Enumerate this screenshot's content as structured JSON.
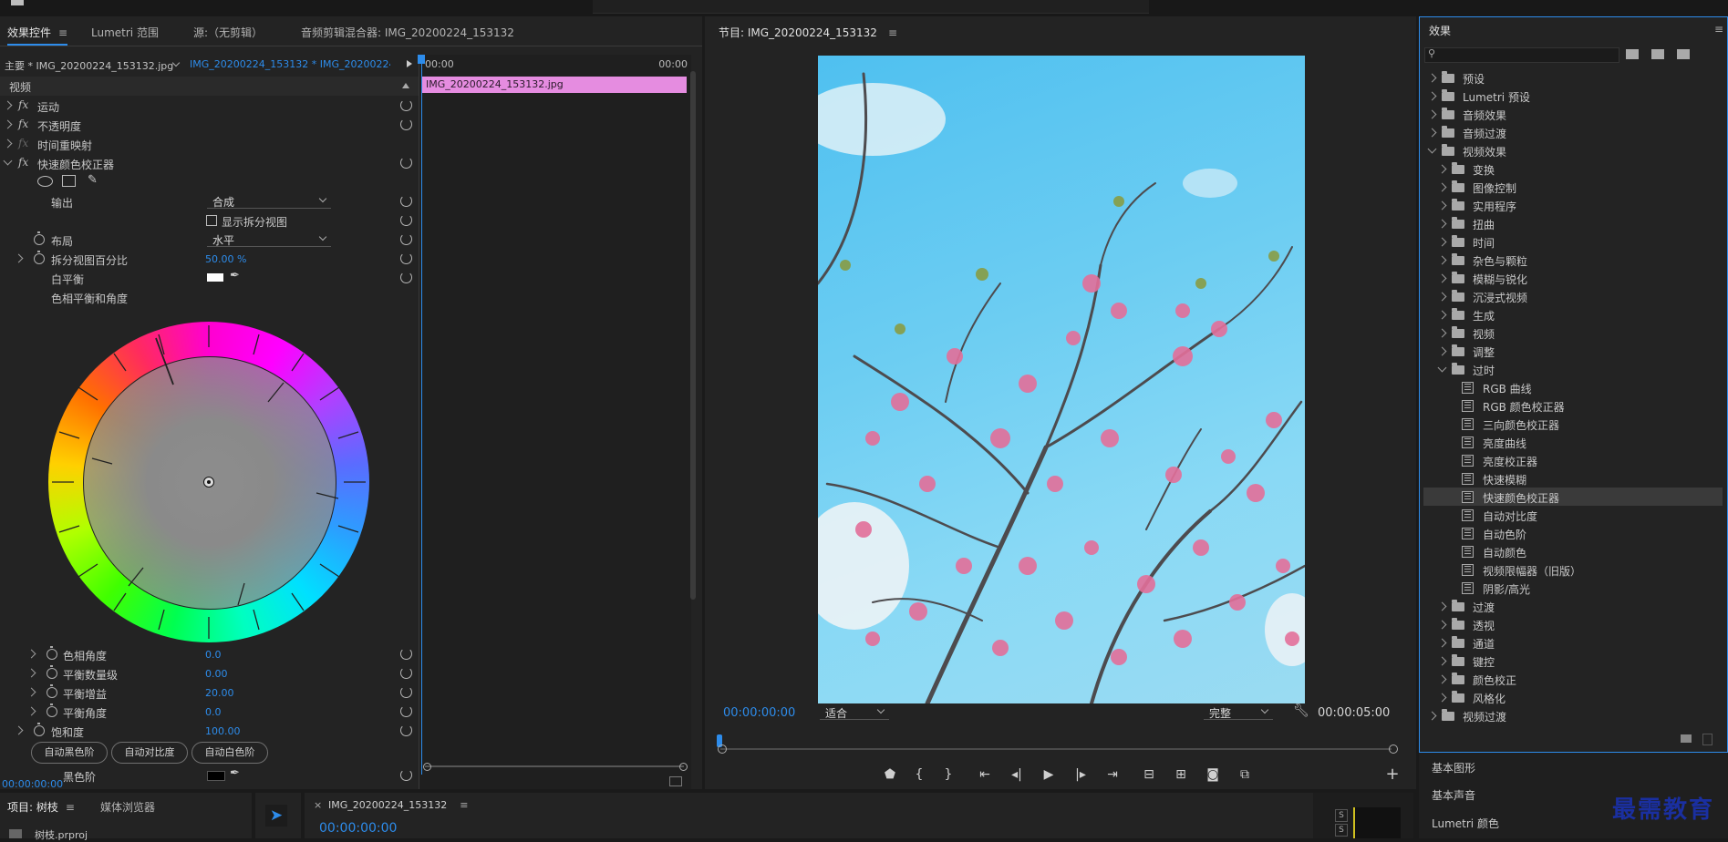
{
  "effect_controls": {
    "tabs": [
      "效果控件",
      "Lumetri 范围",
      "源:（无剪辑）",
      "音频剪辑混合器: IMG_20200224_153132"
    ],
    "master_label": "主要 * IMG_20200224_153132.jpg",
    "sequence_label": "IMG_20200224_153132 * IMG_20200224_...",
    "video_section": "视频",
    "time_start": "00:00",
    "time_end": "00:00",
    "clip_name": "IMG_20200224_153132.jpg",
    "effects": {
      "motion": "运动",
      "opacity": "不透明度",
      "time_remap": "时间重映射",
      "fast_color": "快速颜色校正器"
    },
    "output_label": "输出",
    "output_value": "合成",
    "show_split_label": "显示拆分视图",
    "layout_label": "布局",
    "layout_value": "水平",
    "split_pct_label": "拆分视图百分比",
    "split_pct_value": "50.00 %",
    "white_balance_label": "白平衡",
    "hue_wheel_label": "色相平衡和角度",
    "hue_angle_label": "色相角度",
    "hue_angle_value": "0.0",
    "balance_mag_label": "平衡数量级",
    "balance_mag_value": "0.00",
    "balance_gain_label": "平衡增益",
    "balance_gain_value": "20.00",
    "balance_angle_label": "平衡角度",
    "balance_angle_value": "0.0",
    "saturation_label": "饱和度",
    "saturation_value": "100.00",
    "auto_black_btn": "自动黑色阶",
    "auto_contrast_btn": "自动对比度",
    "auto_white_btn": "自动白色阶",
    "black_level_label": "黑色阶",
    "timecode": "00:00:00:00"
  },
  "program": {
    "title": "节目: IMG_20200224_153132",
    "timecode": "00:00:00:00",
    "fit": "适合",
    "quality": "完整",
    "duration": "00:00:05:00"
  },
  "effects_panel": {
    "title": "效果",
    "items": [
      {
        "label": "预设",
        "depth": 0,
        "type": "folder-star",
        "expanded": false
      },
      {
        "label": "Lumetri 预设",
        "depth": 0,
        "type": "folder-star",
        "expanded": false
      },
      {
        "label": "音频效果",
        "depth": 0,
        "type": "folder",
        "expanded": false
      },
      {
        "label": "音频过渡",
        "depth": 0,
        "type": "folder",
        "expanded": false
      },
      {
        "label": "视频效果",
        "depth": 0,
        "type": "folder",
        "expanded": true
      },
      {
        "label": "变换",
        "depth": 1,
        "type": "folder",
        "expanded": false
      },
      {
        "label": "图像控制",
        "depth": 1,
        "type": "folder",
        "expanded": false
      },
      {
        "label": "实用程序",
        "depth": 1,
        "type": "folder",
        "expanded": false
      },
      {
        "label": "扭曲",
        "depth": 1,
        "type": "folder",
        "expanded": false
      },
      {
        "label": "时间",
        "depth": 1,
        "type": "folder",
        "expanded": false
      },
      {
        "label": "杂色与颗粒",
        "depth": 1,
        "type": "folder",
        "expanded": false
      },
      {
        "label": "模糊与锐化",
        "depth": 1,
        "type": "folder",
        "expanded": false
      },
      {
        "label": "沉浸式视频",
        "depth": 1,
        "type": "folder",
        "expanded": false
      },
      {
        "label": "生成",
        "depth": 1,
        "type": "folder",
        "expanded": false
      },
      {
        "label": "视频",
        "depth": 1,
        "type": "folder",
        "expanded": false
      },
      {
        "label": "调整",
        "depth": 1,
        "type": "folder",
        "expanded": false
      },
      {
        "label": "过时",
        "depth": 1,
        "type": "folder",
        "expanded": true
      },
      {
        "label": "RGB 曲线",
        "depth": 2,
        "type": "effect"
      },
      {
        "label": "RGB 颜色校正器",
        "depth": 2,
        "type": "effect"
      },
      {
        "label": "三向颜色校正器",
        "depth": 2,
        "type": "effect"
      },
      {
        "label": "亮度曲线",
        "depth": 2,
        "type": "effect"
      },
      {
        "label": "亮度校正器",
        "depth": 2,
        "type": "effect"
      },
      {
        "label": "快速模糊",
        "depth": 2,
        "type": "effect"
      },
      {
        "label": "快速颜色校正器",
        "depth": 2,
        "type": "effect",
        "selected": true
      },
      {
        "label": "自动对比度",
        "depth": 2,
        "type": "effect"
      },
      {
        "label": "自动色阶",
        "depth": 2,
        "type": "effect"
      },
      {
        "label": "自动颜色",
        "depth": 2,
        "type": "effect"
      },
      {
        "label": "视频限幅器（旧版）",
        "depth": 2,
        "type": "effect"
      },
      {
        "label": "阴影/高光",
        "depth": 2,
        "type": "effect"
      },
      {
        "label": "过渡",
        "depth": 1,
        "type": "folder",
        "expanded": false
      },
      {
        "label": "透视",
        "depth": 1,
        "type": "folder",
        "expanded": false
      },
      {
        "label": "通道",
        "depth": 1,
        "type": "folder",
        "expanded": false
      },
      {
        "label": "键控",
        "depth": 1,
        "type": "folder",
        "expanded": false
      },
      {
        "label": "颜色校正",
        "depth": 1,
        "type": "folder",
        "expanded": false
      },
      {
        "label": "风格化",
        "depth": 1,
        "type": "folder",
        "expanded": false
      },
      {
        "label": "视频过渡",
        "depth": 0,
        "type": "folder",
        "expanded": false
      }
    ],
    "bottom_panels": [
      "基本图形",
      "基本声音",
      "Lumetri 颜色"
    ]
  },
  "bottom": {
    "project_tab": "项目: 树枝",
    "media_tab": "媒体浏览器",
    "project_file": "树枝.prproj",
    "sequence_tab": "IMG_20200224_153132",
    "sequence_time": "00:00:00:00"
  },
  "watermark": "最需教育",
  "colors": {
    "accent": "#2d8ceb",
    "clip": "#e58ce0",
    "selection": "#3a3a3a"
  }
}
